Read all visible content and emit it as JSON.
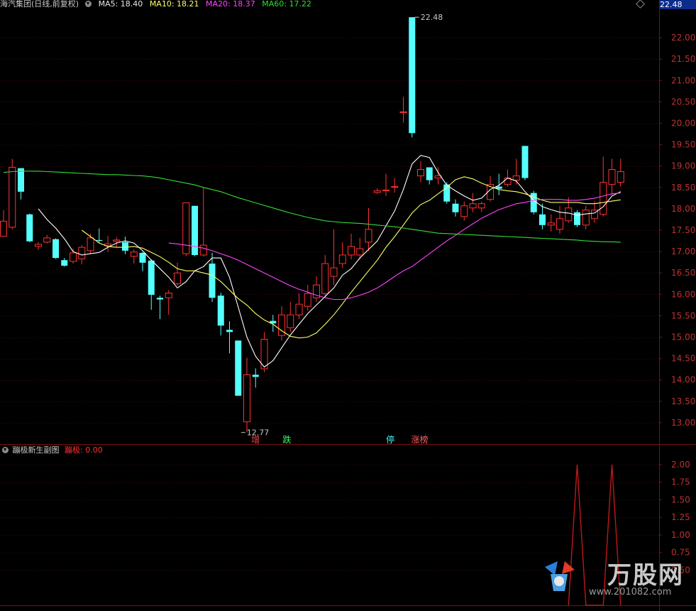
{
  "legend": {
    "stock": "海汽集团(日线,前复权)",
    "ma5": "MA5: 18.40",
    "ma10": "MA10: 18.21",
    "ma20": "MA20: 18.37",
    "ma60": "MA60: 17.22"
  },
  "last_price_tag": "22.48",
  "indicator": {
    "title": "蹦极新生副图",
    "value_label": "蹦极: 0.00"
  },
  "signals": [
    "增",
    "跌",
    "停",
    "涨榜"
  ],
  "colors": {
    "up": "#ff3232",
    "down": "#54ffff",
    "grid": "#7a1010",
    "axis_text": "#c03030",
    "ma5": "#ffffff",
    "ma10": "#ffff66",
    "ma20": "#ff44ff",
    "ma60": "#33dd33",
    "indicator": "#c01818"
  },
  "watermark": {
    "name": "万股网",
    "url": "www.201082.com"
  },
  "chart_data": [
    {
      "type": "candlestick",
      "title": "海汽集团(日线,前复权)",
      "y_ticks": [
        "22.00",
        "21.50",
        "21.00",
        "20.50",
        "20.00",
        "19.50",
        "19.00",
        "18.50",
        "18.00",
        "17.50",
        "17.00",
        "16.50",
        "16.00",
        "15.50",
        "15.00",
        "14.50",
        "14.00",
        "13.50",
        "13.00"
      ],
      "ylim": [
        12.5,
        22.65
      ],
      "annotations": [
        {
          "text": "22.48",
          "x": 47,
          "y": 22.48
        },
        {
          "text": "12.77",
          "x": 27,
          "y": 12.77
        }
      ],
      "candles": [
        {
          "o": 17.36,
          "c": 17.71,
          "h": 17.97,
          "l": 17.37,
          "dir": "up"
        },
        {
          "o": 17.57,
          "c": 18.97,
          "h": 19.17,
          "l": 17.52,
          "dir": "up"
        },
        {
          "o": 18.95,
          "c": 18.4,
          "h": 18.95,
          "l": 18.22,
          "dir": "down"
        },
        {
          "o": 17.87,
          "c": 17.24,
          "h": 17.89,
          "l": 17.22,
          "dir": "down"
        },
        {
          "o": 17.17,
          "c": 17.12,
          "h": 17.22,
          "l": 17.04,
          "dir": "up"
        },
        {
          "o": 17.32,
          "c": 17.22,
          "h": 17.39,
          "l": 17.19,
          "dir": "up"
        },
        {
          "o": 17.29,
          "c": 16.85,
          "h": 17.31,
          "l": 16.83,
          "dir": "down"
        },
        {
          "o": 16.8,
          "c": 16.67,
          "h": 16.85,
          "l": 16.65,
          "dir": "down"
        },
        {
          "o": 16.77,
          "c": 16.97,
          "h": 17.07,
          "l": 16.72,
          "dir": "up"
        },
        {
          "o": 16.83,
          "c": 17.1,
          "h": 17.15,
          "l": 16.7,
          "dir": "up"
        },
        {
          "o": 17.02,
          "c": 17.32,
          "h": 17.42,
          "l": 16.96,
          "dir": "up"
        },
        {
          "o": 17.25,
          "c": 17.27,
          "h": 17.54,
          "l": 17.2,
          "dir": "down"
        },
        {
          "o": 17.14,
          "c": 17.18,
          "h": 17.37,
          "l": 16.99,
          "dir": "up"
        },
        {
          "o": 17.27,
          "c": 17.24,
          "h": 17.34,
          "l": 17.1,
          "dir": "up"
        },
        {
          "o": 17.22,
          "c": 17.02,
          "h": 17.35,
          "l": 16.94,
          "dir": "down"
        },
        {
          "o": 16.89,
          "c": 16.99,
          "h": 17.05,
          "l": 16.72,
          "dir": "up"
        },
        {
          "o": 16.97,
          "c": 16.74,
          "h": 16.99,
          "l": 16.54,
          "dir": "down"
        },
        {
          "o": 16.79,
          "c": 15.99,
          "h": 16.82,
          "l": 15.64,
          "dir": "down"
        },
        {
          "o": 15.92,
          "c": 15.88,
          "h": 15.97,
          "l": 15.42,
          "dir": "down"
        },
        {
          "o": 15.92,
          "c": 16.03,
          "h": 16.1,
          "l": 15.52,
          "dir": "up"
        },
        {
          "o": 16.25,
          "c": 16.5,
          "h": 16.74,
          "l": 16.2,
          "dir": "up"
        },
        {
          "o": 16.95,
          "c": 18.14,
          "h": 18.14,
          "l": 16.89,
          "dir": "up"
        },
        {
          "o": 18.07,
          "c": 16.92,
          "h": 18.07,
          "l": 16.89,
          "dir": "down"
        },
        {
          "o": 16.92,
          "c": 17.15,
          "h": 18.5,
          "l": 16.89,
          "dir": "up"
        },
        {
          "o": 16.72,
          "c": 15.92,
          "h": 16.97,
          "l": 15.82,
          "dir": "down"
        },
        {
          "o": 15.97,
          "c": 15.27,
          "h": 16.04,
          "l": 15.04,
          "dir": "down"
        },
        {
          "o": 15.17,
          "c": 15.12,
          "h": 15.37,
          "l": 14.62,
          "dir": "down"
        },
        {
          "o": 14.92,
          "c": 13.63,
          "h": 14.92,
          "l": 13.63,
          "dir": "down"
        },
        {
          "o": 13.02,
          "c": 14.12,
          "h": 14.52,
          "l": 12.77,
          "dir": "up"
        },
        {
          "o": 14.12,
          "c": 14.07,
          "h": 14.27,
          "l": 13.82,
          "dir": "down"
        },
        {
          "o": 14.26,
          "c": 14.95,
          "h": 15.12,
          "l": 14.18,
          "dir": "up"
        },
        {
          "o": 15.32,
          "c": 15.38,
          "h": 15.52,
          "l": 15.12,
          "dir": "down"
        },
        {
          "o": 15.04,
          "c": 15.52,
          "h": 15.72,
          "l": 14.92,
          "dir": "up"
        },
        {
          "o": 15.22,
          "c": 15.52,
          "h": 15.82,
          "l": 15.12,
          "dir": "up"
        },
        {
          "o": 15.52,
          "c": 15.77,
          "h": 16.02,
          "l": 15.42,
          "dir": "up"
        },
        {
          "o": 15.72,
          "c": 16.02,
          "h": 16.22,
          "l": 15.62,
          "dir": "up"
        },
        {
          "o": 15.92,
          "c": 16.22,
          "h": 16.42,
          "l": 15.82,
          "dir": "up"
        },
        {
          "o": 16.02,
          "c": 16.72,
          "h": 16.92,
          "l": 15.92,
          "dir": "up"
        },
        {
          "o": 16.42,
          "c": 16.62,
          "h": 17.52,
          "l": 16.22,
          "dir": "up"
        },
        {
          "o": 16.72,
          "c": 16.92,
          "h": 17.22,
          "l": 16.62,
          "dir": "up"
        },
        {
          "o": 16.92,
          "c": 17.12,
          "h": 17.42,
          "l": 16.82,
          "dir": "up"
        },
        {
          "o": 16.92,
          "c": 17.07,
          "h": 17.32,
          "l": 16.82,
          "dir": "up"
        },
        {
          "o": 17.22,
          "c": 17.52,
          "h": 18.02,
          "l": 17.02,
          "dir": "up"
        },
        {
          "o": 18.38,
          "c": 18.42,
          "h": 18.48,
          "l": 18.35,
          "dir": "up"
        },
        {
          "o": 18.42,
          "c": 18.44,
          "h": 18.82,
          "l": 18.3,
          "dir": "up"
        },
        {
          "o": 18.52,
          "c": 18.52,
          "h": 18.72,
          "l": 18.38,
          "dir": "up"
        },
        {
          "o": 20.25,
          "c": 20.27,
          "h": 20.62,
          "l": 20.02,
          "dir": "up"
        },
        {
          "o": 22.48,
          "c": 19.77,
          "h": 22.48,
          "l": 19.67,
          "dir": "down"
        },
        {
          "o": 18.77,
          "c": 18.92,
          "h": 19.12,
          "l": 18.62,
          "dir": "up"
        },
        {
          "o": 18.97,
          "c": 18.67,
          "h": 18.97,
          "l": 18.57,
          "dir": "down"
        },
        {
          "o": 18.72,
          "c": 18.77,
          "h": 18.97,
          "l": 18.57,
          "dir": "up"
        },
        {
          "o": 18.57,
          "c": 18.17,
          "h": 18.62,
          "l": 18.12,
          "dir": "down"
        },
        {
          "o": 18.12,
          "c": 17.92,
          "h": 18.22,
          "l": 17.82,
          "dir": "down"
        },
        {
          "o": 17.82,
          "c": 18.07,
          "h": 18.17,
          "l": 17.72,
          "dir": "up"
        },
        {
          "o": 18.02,
          "c": 18.12,
          "h": 18.37,
          "l": 17.92,
          "dir": "up"
        },
        {
          "o": 18.02,
          "c": 18.12,
          "h": 18.17,
          "l": 17.92,
          "dir": "up"
        },
        {
          "o": 18.22,
          "c": 18.57,
          "h": 18.77,
          "l": 18.17,
          "dir": "up"
        },
        {
          "o": 18.52,
          "c": 18.47,
          "h": 18.82,
          "l": 18.32,
          "dir": "down"
        },
        {
          "o": 18.57,
          "c": 18.72,
          "h": 18.92,
          "l": 18.52,
          "dir": "up"
        },
        {
          "o": 18.67,
          "c": 18.77,
          "h": 19.17,
          "l": 18.57,
          "dir": "up"
        },
        {
          "o": 19.47,
          "c": 18.72,
          "h": 19.47,
          "l": 18.67,
          "dir": "down"
        },
        {
          "o": 18.37,
          "c": 17.92,
          "h": 18.42,
          "l": 17.87,
          "dir": "down"
        },
        {
          "o": 17.87,
          "c": 17.62,
          "h": 18.12,
          "l": 17.52,
          "dir": "down"
        },
        {
          "o": 17.62,
          "c": 17.67,
          "h": 17.87,
          "l": 17.47,
          "dir": "up"
        },
        {
          "o": 17.52,
          "c": 17.77,
          "h": 18.07,
          "l": 17.42,
          "dir": "up"
        },
        {
          "o": 17.72,
          "c": 18.02,
          "h": 18.27,
          "l": 17.67,
          "dir": "up"
        },
        {
          "o": 17.92,
          "c": 17.62,
          "h": 17.97,
          "l": 17.57,
          "dir": "down"
        },
        {
          "o": 17.62,
          "c": 17.97,
          "h": 18.07,
          "l": 17.52,
          "dir": "up"
        },
        {
          "o": 17.77,
          "c": 17.97,
          "h": 18.17,
          "l": 17.67,
          "dir": "up"
        },
        {
          "o": 17.87,
          "c": 18.62,
          "h": 19.22,
          "l": 17.82,
          "dir": "up"
        },
        {
          "o": 18.57,
          "c": 18.92,
          "h": 19.17,
          "l": 18.32,
          "dir": "up"
        },
        {
          "o": 18.62,
          "c": 18.87,
          "h": 19.17,
          "l": 18.52,
          "dir": "up"
        }
      ],
      "series": [
        {
          "name": "MA5",
          "values": [
            null,
            null,
            null,
            null,
            18.0,
            17.75,
            17.55,
            17.3,
            17.0,
            16.92,
            16.95,
            16.98,
            17.1,
            17.2,
            17.25,
            17.2,
            17.02,
            16.8,
            16.6,
            16.4,
            16.15,
            16.3,
            16.55,
            16.65,
            16.85,
            16.85,
            16.4,
            15.7,
            15.0,
            14.55,
            14.3,
            14.45,
            14.75,
            15.05,
            15.3,
            15.55,
            15.75,
            15.95,
            16.15,
            16.45,
            16.6,
            16.85,
            17.05,
            17.25,
            17.6,
            17.95,
            18.45,
            19.05,
            19.25,
            19.2,
            18.85,
            18.55,
            18.42,
            18.3,
            18.2,
            18.25,
            18.45,
            18.55,
            18.72,
            18.65,
            18.4,
            18.2,
            18.05,
            17.98,
            17.92,
            17.9,
            17.85,
            17.88,
            17.9,
            18.05,
            18.3,
            18.4
          ]
        },
        {
          "name": "MA10",
          "values": [
            null,
            null,
            null,
            null,
            null,
            null,
            null,
            null,
            null,
            17.5,
            17.35,
            17.2,
            17.12,
            17.1,
            17.1,
            17.12,
            17.08,
            16.98,
            16.88,
            16.75,
            16.6,
            16.55,
            16.55,
            16.5,
            16.45,
            16.3,
            16.1,
            15.9,
            15.75,
            15.55,
            15.4,
            15.3,
            15.15,
            15.02,
            14.98,
            15.0,
            15.1,
            15.3,
            15.52,
            15.78,
            16.05,
            16.3,
            16.55,
            16.8,
            17.1,
            17.35,
            17.62,
            17.9,
            18.1,
            18.2,
            18.35,
            18.5,
            18.68,
            18.75,
            18.7,
            18.6,
            18.52,
            18.45,
            18.42,
            18.4,
            18.35,
            18.28,
            18.2,
            18.15,
            18.15,
            18.15,
            18.15,
            18.12,
            18.12,
            18.15,
            18.18,
            18.21
          ]
        },
        {
          "name": "MA20",
          "values": [
            null,
            null,
            null,
            null,
            null,
            null,
            null,
            null,
            null,
            null,
            null,
            null,
            null,
            null,
            null,
            null,
            null,
            null,
            null,
            17.2,
            17.18,
            17.15,
            17.12,
            17.08,
            17.02,
            16.95,
            16.88,
            16.8,
            16.7,
            16.6,
            16.5,
            16.4,
            16.3,
            16.2,
            16.12,
            16.05,
            15.98,
            15.92,
            15.88,
            15.88,
            15.92,
            15.98,
            16.05,
            16.15,
            16.28,
            16.42,
            16.55,
            16.65,
            16.8,
            16.95,
            17.1,
            17.25,
            17.38,
            17.52,
            17.65,
            17.78,
            17.88,
            17.98,
            18.05,
            18.12,
            18.15,
            18.2,
            18.22,
            18.22,
            18.22,
            18.2,
            18.2,
            18.22,
            18.25,
            18.3,
            18.35,
            18.37
          ]
        },
        {
          "name": "MA60",
          "values": [
            18.85,
            18.87,
            18.88,
            18.88,
            18.88,
            18.87,
            18.86,
            18.85,
            18.84,
            18.83,
            18.82,
            18.81,
            18.8,
            18.8,
            18.79,
            18.78,
            18.77,
            18.75,
            18.72,
            18.68,
            18.64,
            18.6,
            18.56,
            18.5,
            18.45,
            18.4,
            18.33,
            18.26,
            18.2,
            18.14,
            18.08,
            18.02,
            17.96,
            17.9,
            17.85,
            17.8,
            17.76,
            17.72,
            17.7,
            17.68,
            17.67,
            17.66,
            17.64,
            17.62,
            17.6,
            17.58,
            17.55,
            17.52,
            17.49,
            17.46,
            17.43,
            17.42,
            17.41,
            17.4,
            17.39,
            17.38,
            17.37,
            17.36,
            17.35,
            17.34,
            17.33,
            17.32,
            17.31,
            17.3,
            17.29,
            17.28,
            17.27,
            17.25,
            17.24,
            17.23,
            17.23,
            17.22
          ]
        }
      ]
    },
    {
      "type": "line",
      "title": "蹦极新生副图",
      "y_ticks": [
        "2.00",
        "1.75",
        "1.50",
        "1.25",
        "1.00",
        "0.75",
        "0.50"
      ],
      "ylim": [
        0,
        2.13
      ],
      "series": [
        {
          "name": "蹦极",
          "points": [
            [
              65,
              0
            ],
            [
              66,
              2.0
            ],
            [
              67,
              0
            ],
            [
              69,
              0
            ],
            [
              70,
              2.0
            ],
            [
              71,
              0
            ]
          ]
        }
      ]
    }
  ]
}
